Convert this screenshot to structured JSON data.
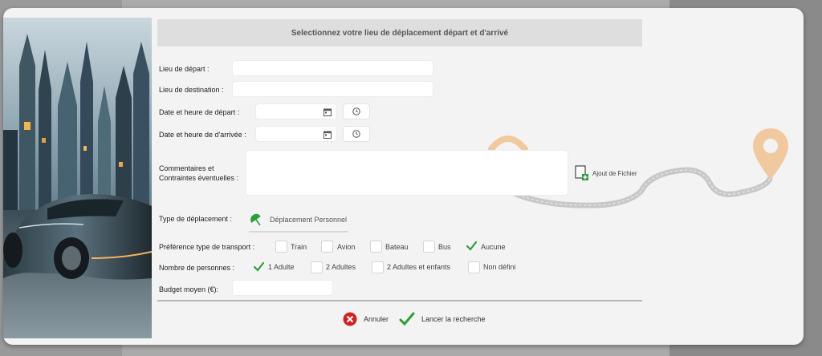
{
  "form": {
    "title": "Selectionnez votre lieu de déplacement départ et d'arrivé",
    "departure_label": "Lieu de départ :",
    "departure_value": "",
    "destination_label": "Lieu de destination :",
    "destination_value": "",
    "departure_datetime_label": "Date et heure de départ :",
    "arrival_datetime_label": "Date et heure de d'arrivée :",
    "comments_label_line1": "Commentaires et",
    "comments_label_line2": "Contraintes éventuelles :",
    "attach_label": "Ajout de Fichier",
    "travel_type_label": "Type de déplacement :",
    "travel_type_value": "Déplacement Personnel",
    "transport_pref_label": "Préférence type de transport :",
    "transport_options": [
      {
        "label": "Train",
        "checked": false
      },
      {
        "label": "Avion",
        "checked": false
      },
      {
        "label": "Bateau",
        "checked": false
      },
      {
        "label": "Bus",
        "checked": false
      },
      {
        "label": "Aucune",
        "checked": true
      }
    ],
    "persons_label": "Nombre de personnes :",
    "persons_options": [
      {
        "label": "1 Adulte",
        "checked": true
      },
      {
        "label": "2 Adultes",
        "checked": false
      },
      {
        "label": "2 Adultes et enfants",
        "checked": false
      },
      {
        "label": "Non défini",
        "checked": false
      }
    ],
    "budget_label": "Budget moyen (€):",
    "budget_value": ""
  },
  "actions": {
    "cancel_label": "Annuler",
    "search_label": "Lancer la recherche"
  },
  "icons": {
    "calendar": "calendar-icon",
    "clock": "clock-icon",
    "attach": "attach-file-icon",
    "umbrella": "umbrella-icon",
    "check": "check-icon",
    "cancel": "cancel-icon",
    "map_pin": "map-pin-icon"
  },
  "colors": {
    "check_green": "#2e9e3a",
    "cancel_red": "#d02424",
    "pin_orange": "#f0c9a0"
  }
}
